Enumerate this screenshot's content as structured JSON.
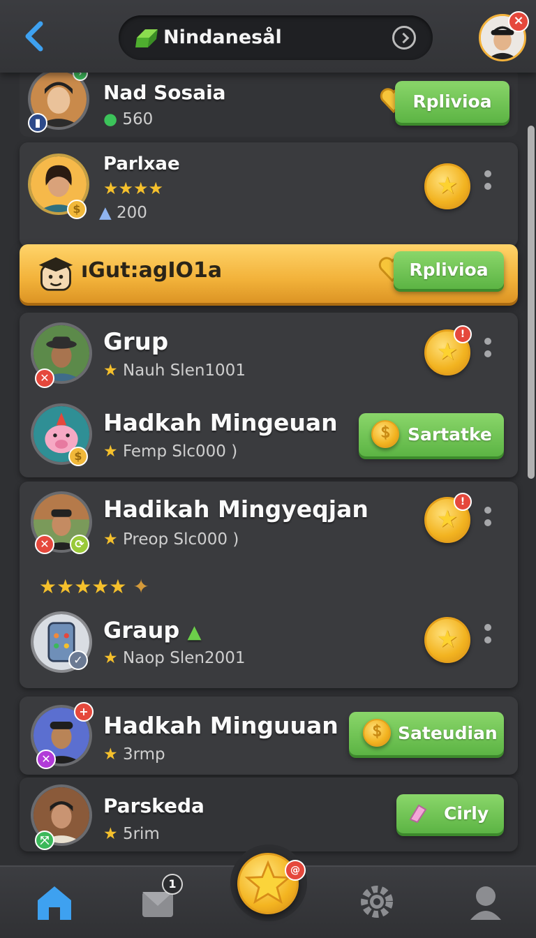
{
  "header": {
    "title": "Nindanesål",
    "back_icon": "back-arrow-icon",
    "go_icon": "chevron-circle-icon",
    "close_badge": "×"
  },
  "rows": {
    "top": {
      "name": "Nad Sosaia",
      "points": "560",
      "action": "Rplivioa",
      "badge": "▮"
    },
    "parlxae": {
      "name": "Parlxae",
      "gems": "200"
    },
    "banner": {
      "title": "ıGut:agIO1a",
      "action": "Rplivioa"
    },
    "grup": {
      "name": "Grup",
      "sub": "Nauh Slen1001",
      "alert": "!"
    },
    "hadkah1": {
      "name": "Hadkah Mingeuan",
      "sub": "Femp Slc000 )",
      "action": "Sartatke"
    },
    "hadikah2": {
      "name": "Hadikah Mingyeqjan",
      "sub": "Preop Slc000 )",
      "alert": "!"
    },
    "graup": {
      "name": "Graup",
      "sub": "Naop Slen2001"
    },
    "hadkah3": {
      "name": "Hadkah Minguuan",
      "sub": "3rmp",
      "action": "Sateudian"
    },
    "parskeda": {
      "name": "Parskeda",
      "sub": "5rim",
      "action": "Cirly"
    }
  },
  "nav": {
    "items": [
      "home",
      "inbox",
      "coin",
      "settings",
      "profile"
    ],
    "inbox_count": "1",
    "center_badge": "@"
  },
  "colors": {
    "accent_green": "#5cb444",
    "gold": "#f2b320",
    "background": "#2f3033",
    "alert_red": "#e5483c"
  }
}
